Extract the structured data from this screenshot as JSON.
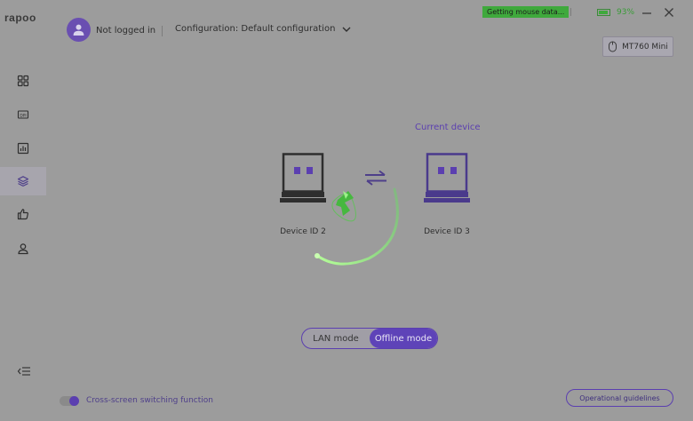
{
  "app": {
    "brand": "rapoo"
  },
  "header": {
    "login_status": "Not logged in",
    "configuration_label": "Configuration: Default configuration",
    "status_badge": "Getting mouse data...",
    "battery_level": "93%",
    "battery_fraction": 0.93,
    "device_name": "MT760 Mini"
  },
  "sidebar": {
    "items": [
      {
        "name": "sidebar-item-home",
        "icon": "grid-icon",
        "active": false
      },
      {
        "name": "sidebar-item-dpi",
        "icon": "dpi-icon",
        "active": false
      },
      {
        "name": "sidebar-item-stats",
        "icon": "chart-icon",
        "active": false
      },
      {
        "name": "sidebar-item-devices",
        "icon": "layers-icon",
        "active": true
      },
      {
        "name": "sidebar-item-recommend",
        "icon": "thumbs-up-icon",
        "active": false
      },
      {
        "name": "sidebar-item-account",
        "icon": "user-icon",
        "active": false
      }
    ]
  },
  "main": {
    "current_device_label": "Current device",
    "devices": [
      {
        "label": "Device ID 2",
        "color": "#2e2e2e"
      },
      {
        "label": "Device ID 3",
        "color": "#4a3a8c"
      }
    ]
  },
  "mode_toggle": {
    "options": [
      "LAN mode",
      "Offline mode"
    ],
    "selected": "Offline mode"
  },
  "footer": {
    "cross_screen_label": "Cross-screen switching function",
    "cross_screen_enabled": true,
    "guidelines_label": "Operational guidelines"
  },
  "colors": {
    "accent": "#5e43b8",
    "status_green": "#3fa93c",
    "spinner_green": "#5ee05a",
    "background": "#9c9c9c"
  }
}
